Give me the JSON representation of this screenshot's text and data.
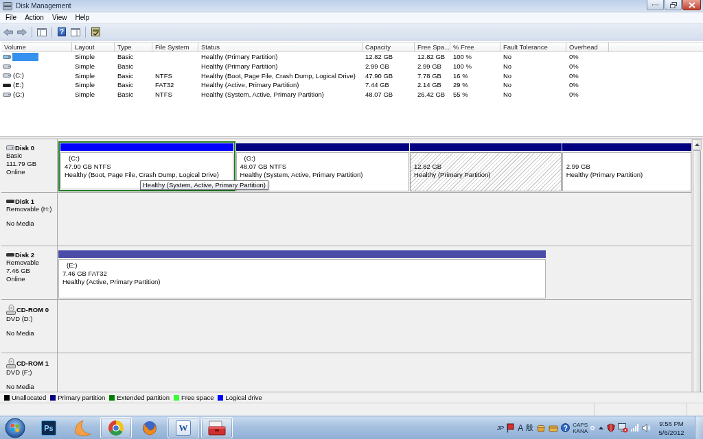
{
  "window": {
    "title": "Disk Management"
  },
  "menu": [
    {
      "label": "File"
    },
    {
      "label": "Action"
    },
    {
      "label": "View"
    },
    {
      "label": "Help"
    }
  ],
  "toolbar": {
    "help": "?"
  },
  "volumes": {
    "columns": [
      "Volume",
      "Layout",
      "Type",
      "File System",
      "Status",
      "Capacity",
      "Free Spa...",
      "% Free",
      "Fault Tolerance",
      "Overhead"
    ],
    "rows": [
      {
        "kind": "disk",
        "selected": true,
        "layout": "Simple",
        "type": "Basic",
        "status": "Healthy (Primary Partition)",
        "capacity": "12.82 GB",
        "free_space": "12.82 GB",
        "percent_free": "100 %",
        "fault_tolerance": "No",
        "overhead": "0%"
      },
      {
        "kind": "disk",
        "selected": false,
        "layout": "Simple",
        "type": "Basic",
        "status": "Healthy (Primary Partition)",
        "capacity": "2.99 GB",
        "free_space": "2.99 GB",
        "percent_free": "100 %",
        "fault_tolerance": "No",
        "overhead": "0%"
      },
      {
        "kind": "disk",
        "selected": false,
        "volume": "(C:)",
        "layout": "Simple",
        "type": "Basic",
        "file_system": "NTFS",
        "status": "Healthy (Boot, Page File, Crash Dump, Logical Drive)",
        "capacity": "47.90 GB",
        "free_space": "7.78 GB",
        "percent_free": "16 %",
        "fault_tolerance": "No",
        "overhead": "0%"
      },
      {
        "kind": "removable",
        "selected": false,
        "volume": "(E:)",
        "layout": "Simple",
        "type": "Basic",
        "file_system": "FAT32",
        "status": "Healthy (Active, Primary Partition)",
        "capacity": "7.44 GB",
        "free_space": "2.14 GB",
        "percent_free": "29 %",
        "fault_tolerance": "No",
        "overhead": "0%"
      },
      {
        "kind": "disk",
        "selected": false,
        "volume": "(G:)",
        "layout": "Simple",
        "type": "Basic",
        "file_system": "NTFS",
        "status": "Healthy (System, Active, Primary Partition)",
        "capacity": "48.07 GB",
        "free_space": "26.42 GB",
        "percent_free": "55 %",
        "fault_tolerance": "No",
        "overhead": "0%"
      }
    ]
  },
  "disks": [
    {
      "kind": "basic",
      "name": "Disk 0",
      "type": "Basic",
      "size": "111.79 GB",
      "state": "Online",
      "partitions": [
        {
          "kind": "logical",
          "label": "(C:)",
          "size": "47.90 GB NTFS",
          "status": "Healthy (Boot, Page File, Crash Dump, Logical Drive)",
          "color": "#0000ff",
          "selected": false
        },
        {
          "kind": "primary",
          "label": "(G:)",
          "size": "48.07 GB NTFS",
          "status": "Healthy (System, Active, Primary Partition)",
          "color": "#000080",
          "selected": false
        },
        {
          "kind": "primary",
          "size": "12.82 GB",
          "status": "Healthy (Primary Partition)",
          "color": "#000080",
          "selected": true
        },
        {
          "kind": "primary",
          "size": "2.99 GB",
          "status": "Healthy (Primary Partition)",
          "color": "#000080",
          "selected": false
        }
      ],
      "tooltip": "Healthy (System, Active, Primary Partition)"
    },
    {
      "kind": "removable",
      "name": "Disk 1",
      "type": "Removable (H:)",
      "state": "No Media"
    },
    {
      "kind": "removable",
      "name": "Disk 2",
      "type": "Removable",
      "size": "7.46 GB",
      "state": "Online",
      "partitions": [
        {
          "kind": "primary",
          "label": "(E:)",
          "size": "7.46 GB FAT32",
          "status": "Healthy (Active, Primary Partition)",
          "color": "#4b4ba8",
          "selected": false
        }
      ]
    },
    {
      "kind": "cdrom",
      "name": "CD-ROM 0",
      "type": "DVD (D:)",
      "state": "No Media"
    },
    {
      "kind": "cdrom",
      "name": "CD-ROM 1",
      "type": "DVD (F:)",
      "state": "No Media"
    }
  ],
  "legend": [
    {
      "label": "Unallocated",
      "color": "#000000"
    },
    {
      "label": "Primary partition",
      "color": "#000080"
    },
    {
      "label": "Extended partition",
      "color": "#008000"
    },
    {
      "label": "Free space",
      "color": "#33ff33"
    },
    {
      "label": "Logical drive",
      "color": "#0000ff"
    }
  ],
  "taskbar": {
    "apps": [
      {
        "kind": "ps",
        "label": "Ps",
        "running": false
      },
      {
        "kind": "crescent",
        "running": false
      },
      {
        "kind": "ring",
        "running": true
      },
      {
        "kind": "globe",
        "running": false
      },
      {
        "kind": "word",
        "label": "W",
        "running": true
      },
      {
        "kind": "toolbox",
        "running": true
      }
    ],
    "tray": {
      "language": "JP",
      "ime_mode": "A",
      "ime_name": "般",
      "help": "?",
      "caps": "CAPS",
      "kana": "KANA",
      "time": "9:56 PM",
      "date": "5/6/2012"
    }
  }
}
